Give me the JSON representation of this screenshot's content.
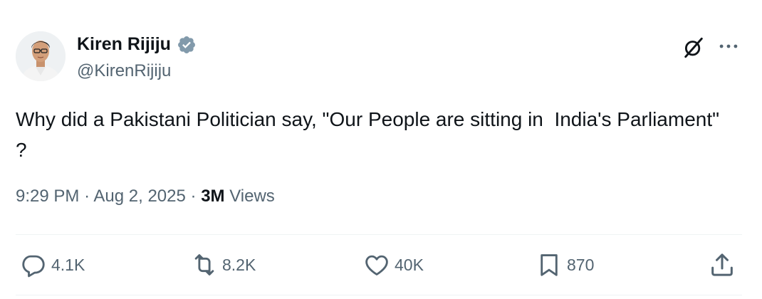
{
  "author": {
    "name": "Kiren Rijiju",
    "handle": "@KirenRijiju",
    "verified": true,
    "avatar_icon": "avatar-photo"
  },
  "tweet": {
    "text": "Why did a Pakistani Politician say, \"Our People are sitting in  India's Parliament\" ?"
  },
  "meta": {
    "time": "9:29 PM",
    "separator": "·",
    "date": "Aug 2, 2025",
    "views_count": "3M",
    "views_label": "Views"
  },
  "actions": {
    "replies": "4.1K",
    "reposts": "8.2K",
    "likes": "40K",
    "bookmarks": "870"
  },
  "icons": {
    "grok": "grok-icon",
    "more": "more-icon",
    "reply": "reply-icon",
    "repost": "repost-icon",
    "like": "like-icon",
    "bookmark": "bookmark-icon",
    "share": "share-icon",
    "verified": "verified-badge-icon"
  },
  "colors": {
    "text_primary": "#0f1419",
    "text_secondary": "#536471",
    "verified_badge": "#829aab",
    "divider": "#eff3f4"
  }
}
